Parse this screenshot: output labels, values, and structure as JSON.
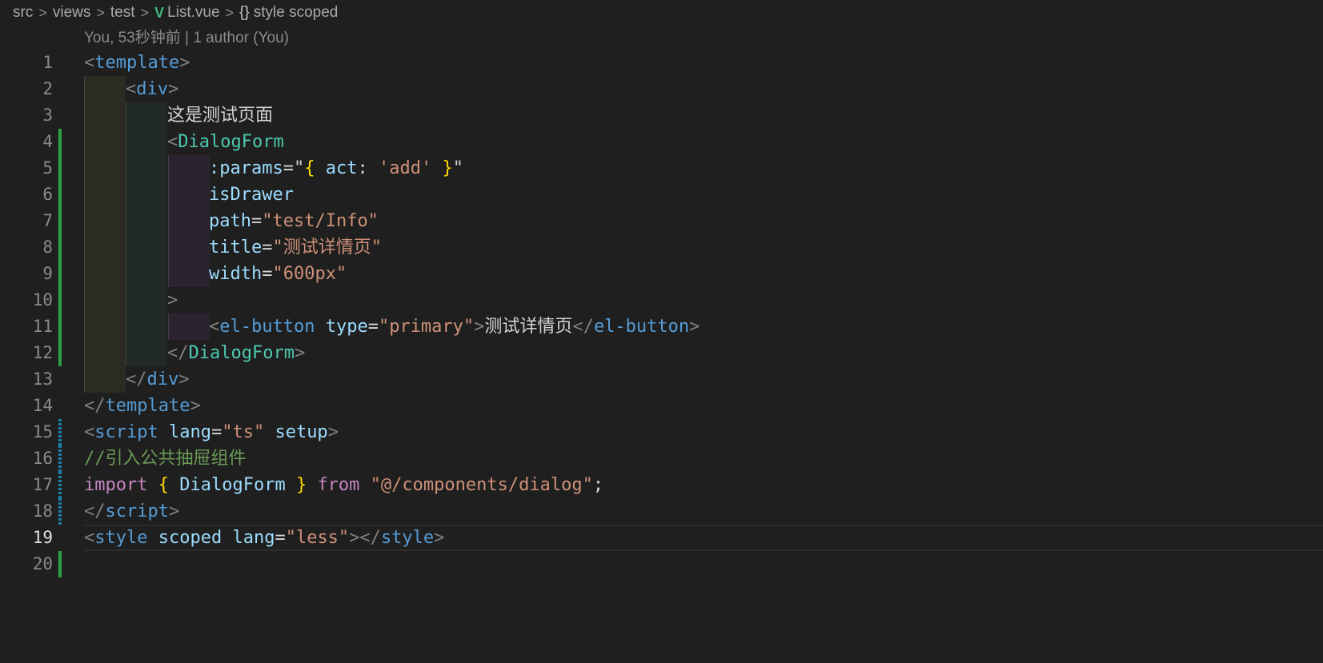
{
  "breadcrumb": {
    "items": [
      "src",
      "views",
      "test",
      "List.vue",
      "style scoped"
    ],
    "separator": ">",
    "vue_icon": "V",
    "style_icon": "{}"
  },
  "blame": {
    "text": "You, 53秒钟前 | 1 author (You)"
  },
  "editor": {
    "active_line": 19,
    "lines": [
      {
        "n": "1",
        "tokens": [
          [
            "p",
            "<"
          ],
          [
            "t",
            "template"
          ],
          [
            "p",
            ">"
          ]
        ]
      },
      {
        "n": "2",
        "tokens": [
          [
            "p",
            "<"
          ],
          [
            "t",
            "div"
          ],
          [
            "p",
            ">"
          ]
        ]
      },
      {
        "n": "3",
        "tokens": [
          [
            "x",
            "这是测试页面"
          ]
        ]
      },
      {
        "n": "4",
        "tokens": [
          [
            "p",
            "<"
          ],
          [
            "c",
            "DialogForm"
          ]
        ]
      },
      {
        "n": "5",
        "tokens": [
          [
            "a",
            ":params"
          ],
          [
            "x",
            "=\""
          ],
          [
            "b",
            "{"
          ],
          [
            "x",
            " "
          ],
          [
            "a",
            "act"
          ],
          [
            "x",
            ": "
          ],
          [
            "s",
            "'add'"
          ],
          [
            "x",
            " "
          ],
          [
            "b",
            "}"
          ],
          [
            "x",
            "\""
          ]
        ]
      },
      {
        "n": "6",
        "tokens": [
          [
            "a",
            "isDrawer"
          ]
        ]
      },
      {
        "n": "7",
        "tokens": [
          [
            "a",
            "path"
          ],
          [
            "x",
            "="
          ],
          [
            "s",
            "\"test/Info\""
          ]
        ]
      },
      {
        "n": "8",
        "tokens": [
          [
            "a",
            "title"
          ],
          [
            "x",
            "="
          ],
          [
            "s",
            "\"测试详情页\""
          ]
        ]
      },
      {
        "n": "9",
        "tokens": [
          [
            "a",
            "width"
          ],
          [
            "x",
            "="
          ],
          [
            "s",
            "\"600px\""
          ]
        ]
      },
      {
        "n": "10",
        "tokens": [
          [
            "p",
            ">"
          ]
        ]
      },
      {
        "n": "11",
        "tokens": [
          [
            "p",
            "<"
          ],
          [
            "t",
            "el-button"
          ],
          [
            "x",
            " "
          ],
          [
            "a",
            "type"
          ],
          [
            "x",
            "="
          ],
          [
            "s",
            "\"primary\""
          ],
          [
            "p",
            ">"
          ],
          [
            "x",
            "测试详情页"
          ],
          [
            "p",
            "</"
          ],
          [
            "t",
            "el-button"
          ],
          [
            "p",
            ">"
          ]
        ]
      },
      {
        "n": "12",
        "tokens": [
          [
            "p",
            "</"
          ],
          [
            "c",
            "DialogForm"
          ],
          [
            "p",
            ">"
          ]
        ]
      },
      {
        "n": "13",
        "tokens": [
          [
            "p",
            "</"
          ],
          [
            "t",
            "div"
          ],
          [
            "p",
            ">"
          ]
        ]
      },
      {
        "n": "14",
        "tokens": [
          [
            "p",
            "</"
          ],
          [
            "t",
            "template"
          ],
          [
            "p",
            ">"
          ]
        ]
      },
      {
        "n": "15",
        "tokens": [
          [
            "p",
            "<"
          ],
          [
            "t",
            "script"
          ],
          [
            "x",
            " "
          ],
          [
            "a",
            "lang"
          ],
          [
            "x",
            "="
          ],
          [
            "s",
            "\"ts\""
          ],
          [
            "x",
            " "
          ],
          [
            "a",
            "setup"
          ],
          [
            "p",
            ">"
          ]
        ]
      },
      {
        "n": "16",
        "tokens": [
          [
            "cm",
            "//引入公共抽屉组件"
          ]
        ]
      },
      {
        "n": "17",
        "tokens": [
          [
            "k",
            "import"
          ],
          [
            "x",
            " "
          ],
          [
            "b",
            "{"
          ],
          [
            "x",
            " "
          ],
          [
            "a",
            "DialogForm"
          ],
          [
            "x",
            " "
          ],
          [
            "b",
            "}"
          ],
          [
            "x",
            " "
          ],
          [
            "k",
            "from"
          ],
          [
            "x",
            " "
          ],
          [
            "s",
            "\"@/components/dialog\""
          ],
          [
            "x",
            ";"
          ]
        ]
      },
      {
        "n": "18",
        "tokens": [
          [
            "p",
            "</"
          ],
          [
            "t",
            "script"
          ],
          [
            "p",
            ">"
          ]
        ]
      },
      {
        "n": "19",
        "tokens": [
          [
            "p",
            "<"
          ],
          [
            "t",
            "style"
          ],
          [
            "x",
            " "
          ],
          [
            "a",
            "scoped"
          ],
          [
            "x",
            " "
          ],
          [
            "a",
            "lang"
          ],
          [
            "x",
            "="
          ],
          [
            "s",
            "\"less\""
          ],
          [
            "p",
            "></"
          ],
          [
            "t",
            "style"
          ],
          [
            "p",
            ">"
          ]
        ]
      },
      {
        "n": "20",
        "tokens": []
      }
    ]
  }
}
